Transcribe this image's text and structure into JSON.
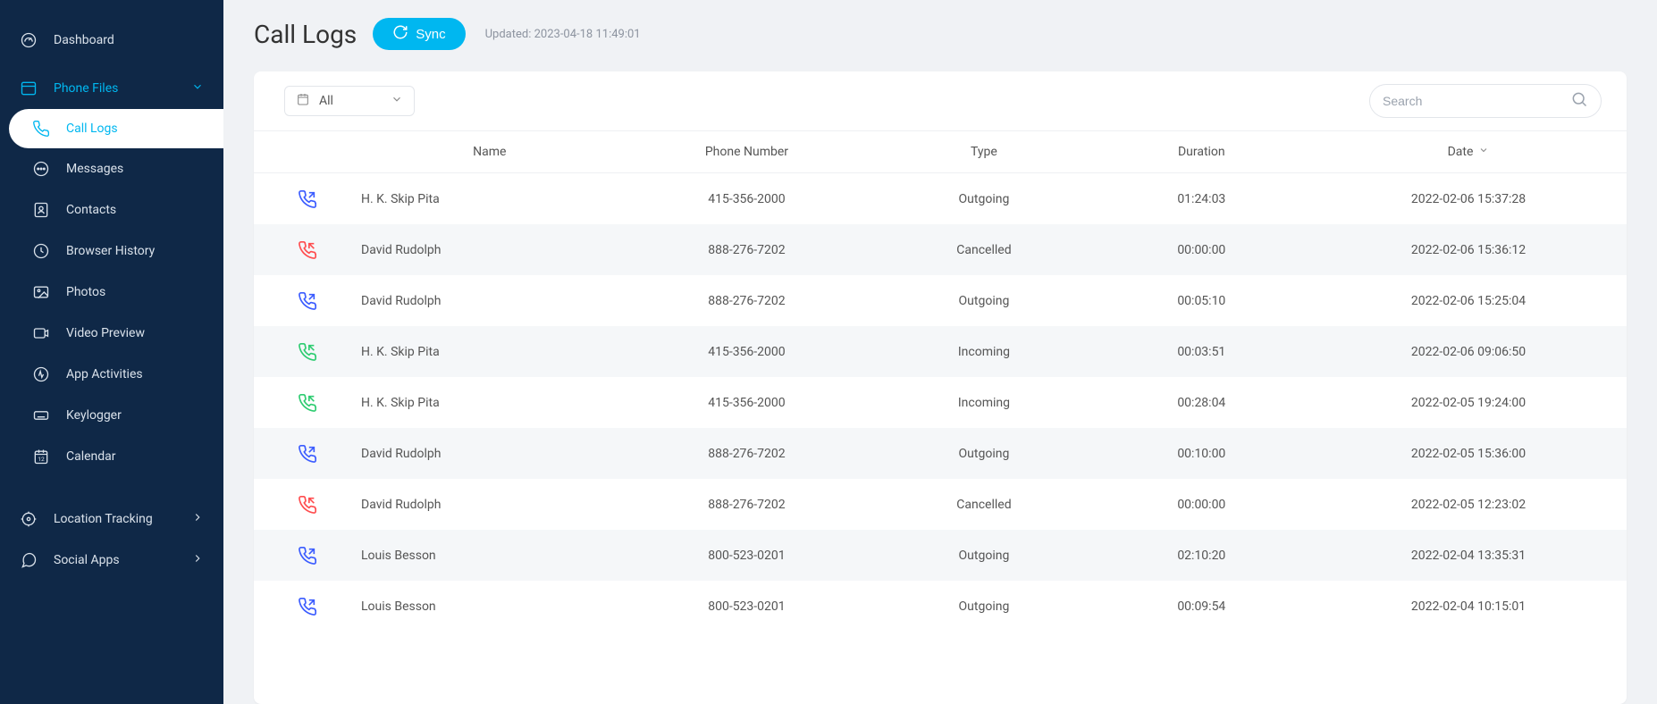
{
  "sidebar": {
    "dashboard": "Dashboard",
    "phone_files": "Phone Files",
    "items": [
      {
        "label": "Call Logs"
      },
      {
        "label": "Messages"
      },
      {
        "label": "Contacts"
      },
      {
        "label": "Browser History"
      },
      {
        "label": "Photos"
      },
      {
        "label": "Video Preview"
      },
      {
        "label": "App Activities"
      },
      {
        "label": "Keylogger"
      },
      {
        "label": "Calendar"
      }
    ],
    "location_tracking": "Location Tracking",
    "social_apps": "Social Apps"
  },
  "header": {
    "title": "Call Logs",
    "sync": "Sync",
    "updated": "Updated: 2023-04-18 11:49:01"
  },
  "toolbar": {
    "filter": "All",
    "search_placeholder": "Search"
  },
  "table": {
    "headers": {
      "name": "Name",
      "phone": "Phone Number",
      "type": "Type",
      "duration": "Duration",
      "date": "Date"
    },
    "rows": [
      {
        "dir": "outgoing",
        "name": "H. K. Skip Pita",
        "phone": "415-356-2000",
        "type": "Outgoing",
        "duration": "01:24:03",
        "date": "2022-02-06 15:37:28"
      },
      {
        "dir": "cancelled",
        "name": "David Rudolph",
        "phone": "888-276-7202",
        "type": "Cancelled",
        "duration": "00:00:00",
        "date": "2022-02-06 15:36:12"
      },
      {
        "dir": "outgoing",
        "name": "David Rudolph",
        "phone": "888-276-7202",
        "type": "Outgoing",
        "duration": "00:05:10",
        "date": "2022-02-06 15:25:04"
      },
      {
        "dir": "incoming",
        "name": "H. K. Skip Pita",
        "phone": "415-356-2000",
        "type": "Incoming",
        "duration": "00:03:51",
        "date": "2022-02-06 09:06:50"
      },
      {
        "dir": "incoming",
        "name": "H. K. Skip Pita",
        "phone": "415-356-2000",
        "type": "Incoming",
        "duration": "00:28:04",
        "date": "2022-02-05 19:24:00"
      },
      {
        "dir": "outgoing",
        "name": "David Rudolph",
        "phone": "888-276-7202",
        "type": "Outgoing",
        "duration": "00:10:00",
        "date": "2022-02-05 15:36:00"
      },
      {
        "dir": "cancelled",
        "name": "David Rudolph",
        "phone": "888-276-7202",
        "type": "Cancelled",
        "duration": "00:00:00",
        "date": "2022-02-05 12:23:02"
      },
      {
        "dir": "outgoing",
        "name": "Louis Besson",
        "phone": "800-523-0201",
        "type": "Outgoing",
        "duration": "02:10:20",
        "date": "2022-02-04 13:35:31"
      },
      {
        "dir": "outgoing",
        "name": "Louis Besson",
        "phone": "800-523-0201",
        "type": "Outgoing",
        "duration": "00:09:54",
        "date": "2022-02-04 10:15:01"
      }
    ]
  }
}
